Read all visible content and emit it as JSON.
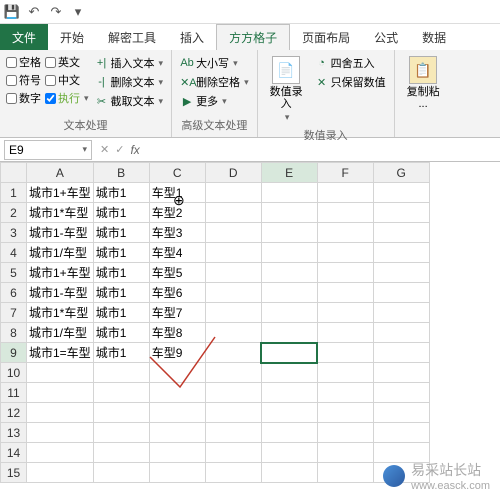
{
  "qat": {
    "save": "💾",
    "undo": "↶",
    "redo": "↷"
  },
  "tabs": {
    "file": "文件",
    "home": "开始",
    "tool": "解密工具",
    "insert": "插入",
    "active": "方方格子",
    "layout": "页面布局",
    "formula": "公式",
    "data": "数据"
  },
  "ribbon": {
    "g1": {
      "label": "文本处理",
      "chk": {
        "space": "空格",
        "en": "英文",
        "symbol": "符号",
        "cn": "中文",
        "num": "数字",
        "exec": "执行"
      },
      "btns": {
        "ins": "插入文本",
        "del": "删除文本",
        "cut": "截取文本"
      }
    },
    "g2": {
      "label": "高级文本处理",
      "btns": {
        "case": "大小写",
        "delsp": "删除空格",
        "more": "更多"
      }
    },
    "g3": {
      "label": "数值录入",
      "big": "数值录\n入",
      "btns": {
        "round": "四舍五入",
        "keep": "只保留数值"
      }
    },
    "g4": {
      "big": "复制粘\n..."
    }
  },
  "namebox": {
    "ref": "E9",
    "fx": "fx"
  },
  "chart_data": {
    "type": "table",
    "columns": [
      "A",
      "B",
      "C",
      "D",
      "E",
      "F",
      "G"
    ],
    "rows": [
      1,
      2,
      3,
      4,
      5,
      6,
      7,
      8,
      9,
      10,
      11,
      12,
      13,
      14,
      15
    ],
    "data": {
      "A": [
        "城市1+车型",
        "城市1*车型",
        "城市1-车型",
        "城市1/车型",
        "城市1+车型",
        "城市1-车型",
        "城市1*车型",
        "城市1/车型",
        "城市1=车型"
      ],
      "B": [
        "城市1",
        "城市1",
        "城市1",
        "城市1",
        "城市1",
        "城市1",
        "城市1",
        "城市1",
        "城市1"
      ],
      "C": [
        "车型1",
        "车型2",
        "车型3",
        "车型4",
        "车型5",
        "车型6",
        "车型7",
        "车型8",
        "车型9"
      ]
    },
    "selected": "E9"
  },
  "watermark": {
    "text": "易采站长站",
    "url": "www.easck.com"
  }
}
